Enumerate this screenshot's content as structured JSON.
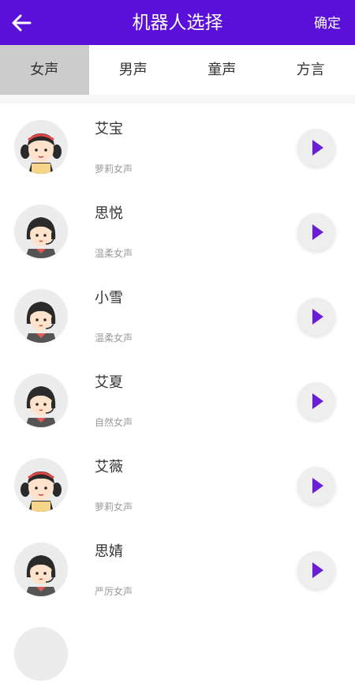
{
  "header": {
    "title": "机器人选择",
    "confirm_label": "确定",
    "back_icon": "arrow-left-icon",
    "bg_color": "#5a10d8"
  },
  "tabs": [
    {
      "label": "女声",
      "active": true
    },
    {
      "label": "男声",
      "active": false
    },
    {
      "label": "童声",
      "active": false
    },
    {
      "label": "方言",
      "active": false
    }
  ],
  "voices": [
    {
      "name": "艾宝",
      "desc": "萝莉女声",
      "avatar": "girl-pigtails"
    },
    {
      "name": "思悦",
      "desc": "温柔女声",
      "avatar": "girl-headset"
    },
    {
      "name": "小雪",
      "desc": "温柔女声",
      "avatar": "girl-headset"
    },
    {
      "name": "艾夏",
      "desc": "自然女声",
      "avatar": "girl-headset"
    },
    {
      "name": "艾薇",
      "desc": "萝莉女声",
      "avatar": "girl-pigtails"
    },
    {
      "name": "思婧",
      "desc": "严厉女声",
      "avatar": "girl-headset"
    }
  ],
  "play_icon": "play-icon",
  "accent_color": "#6a1fd6"
}
